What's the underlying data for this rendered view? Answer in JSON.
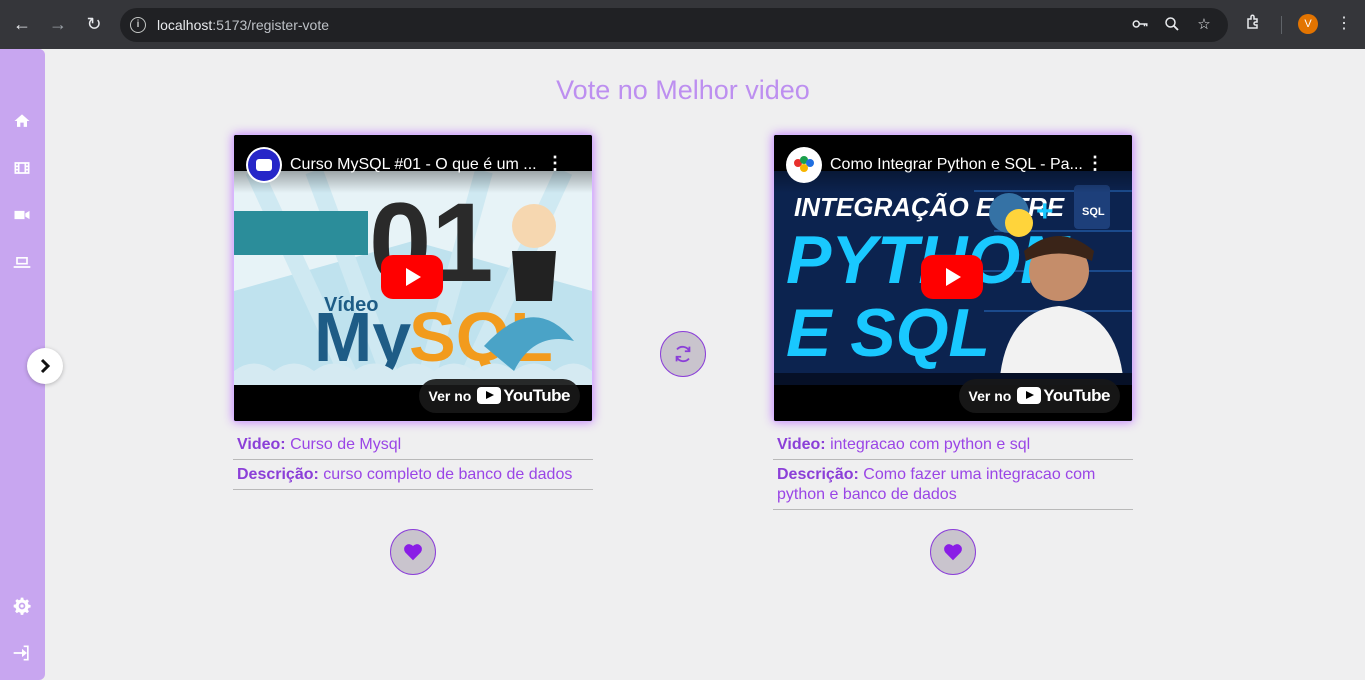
{
  "browser": {
    "url_host": "localhost",
    "url_path": ":5173/register-vote",
    "profile_initial": "V",
    "icons": [
      "back-arrow-icon",
      "forward-arrow-icon",
      "reload-icon",
      "site-info-icon",
      "password-key-icon",
      "zoom-icon",
      "bookmark-star-icon",
      "extensions-icon",
      "more-menu-icon"
    ]
  },
  "sidebar": {
    "items": [
      {
        "icon": "home-icon"
      },
      {
        "icon": "film-icon"
      },
      {
        "icon": "video-camera-icon"
      },
      {
        "icon": "laptop-icon"
      },
      {
        "icon": "settings-gear-icon"
      },
      {
        "icon": "sign-in-icon"
      }
    ]
  },
  "page": {
    "title": "Vote no Melhor video"
  },
  "cards": [
    {
      "video_title": "Curso MySQL #01 - O que é um ...",
      "watch_on": "Ver no",
      "youtube": "YouTube",
      "video_label": "Video:",
      "video_name": "Curso de Mysql",
      "desc_label": "Descrição:",
      "description": "curso completo de banco de dados"
    },
    {
      "video_title": "Como Integrar Python e SQL - Pa...",
      "watch_on": "Ver no",
      "youtube": "YouTube",
      "video_label": "Video:",
      "video_name": "integracao com python e sql",
      "desc_label": "Descrição:",
      "description": "Como fazer uma integracao com python e banco de dados"
    }
  ],
  "colors": {
    "accent": "#8b3fd8",
    "title": "#bd8ff0",
    "sidebar": "#c8a6f0"
  }
}
